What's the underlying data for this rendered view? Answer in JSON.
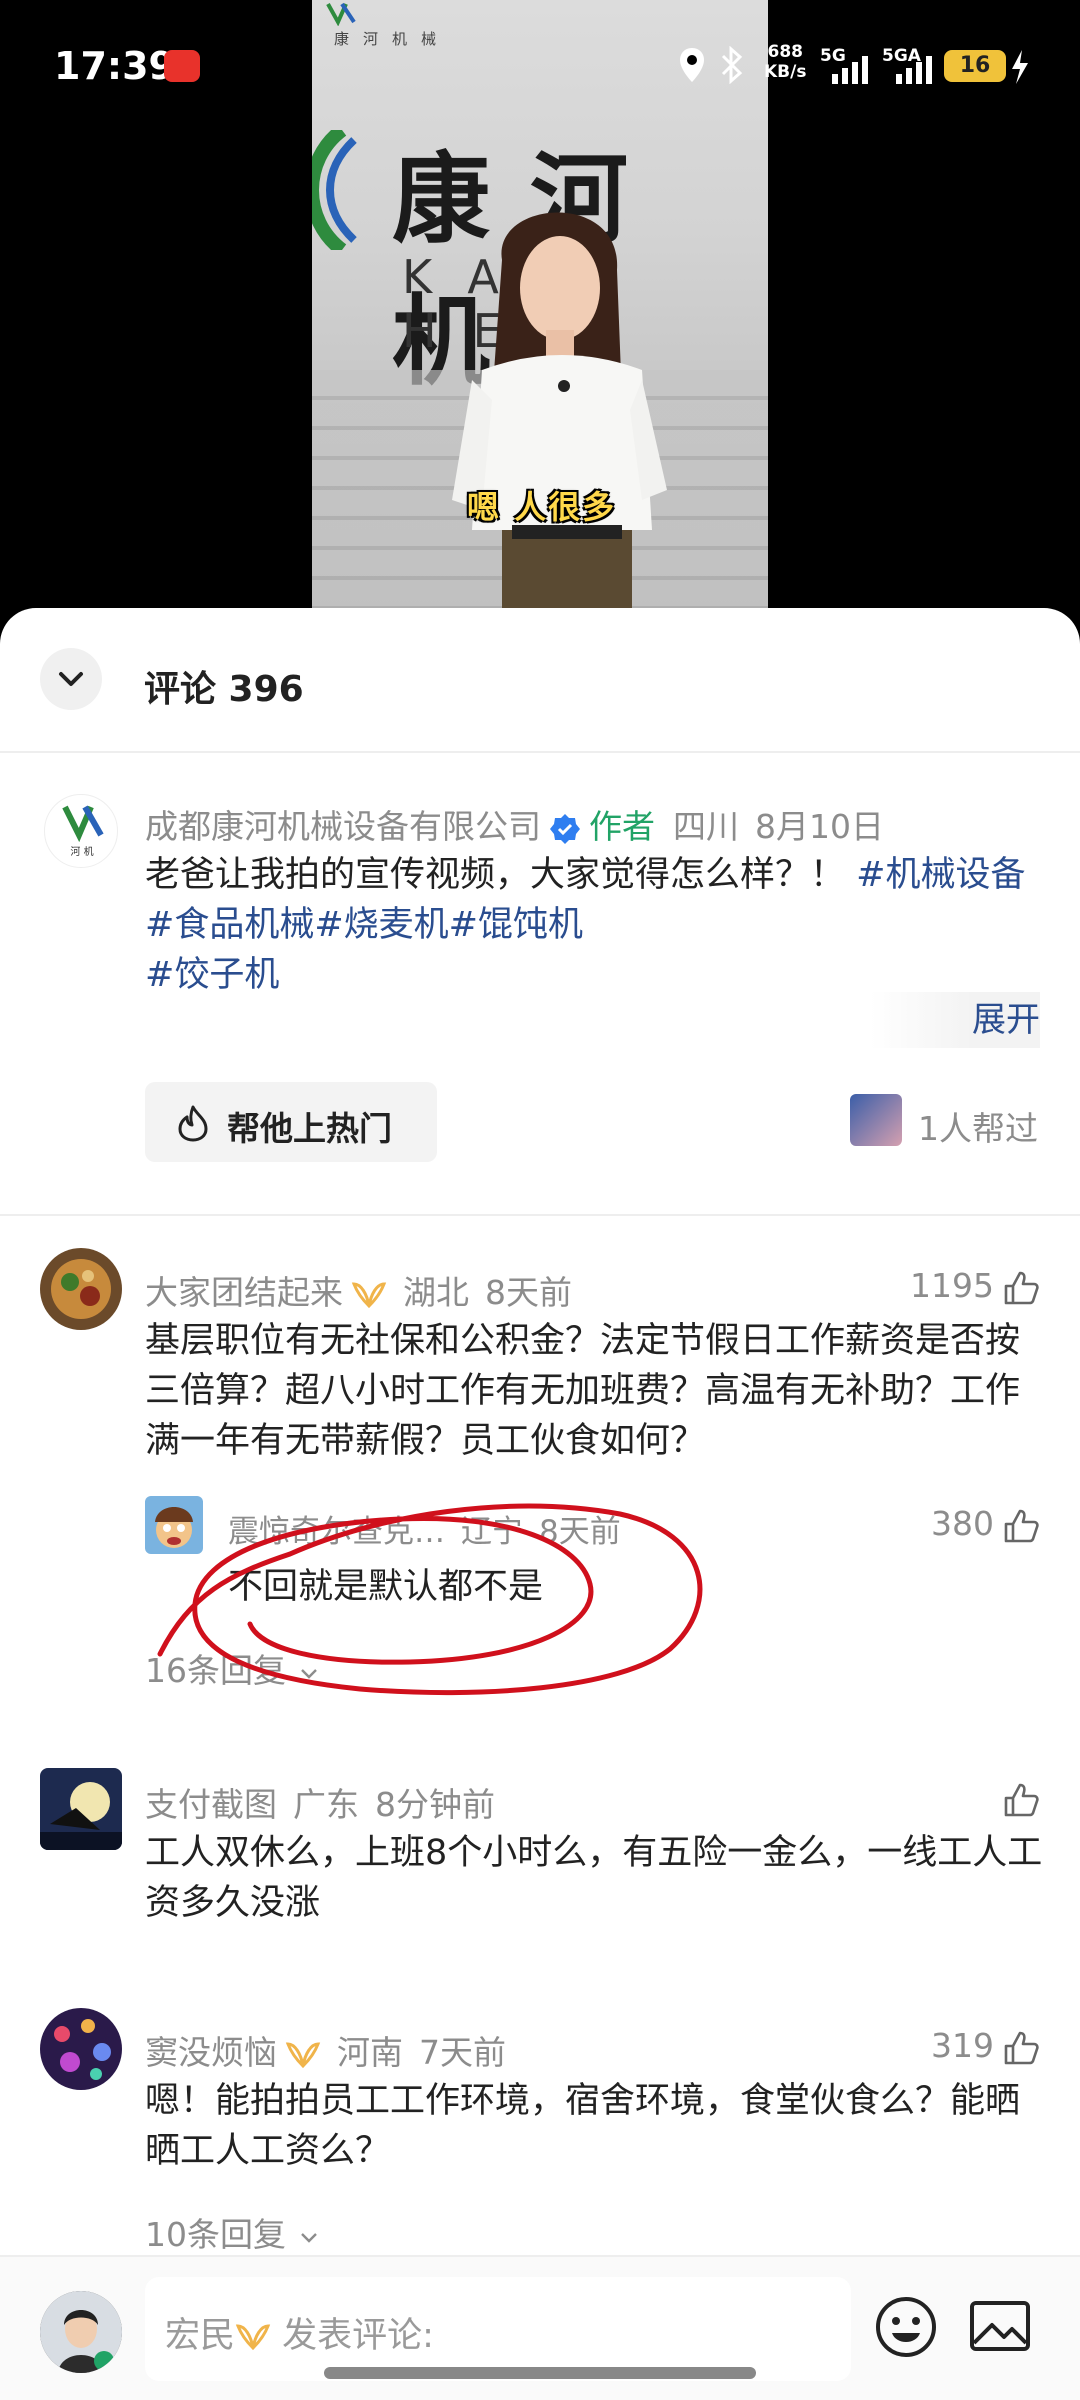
{
  "status_bar": {
    "time": "17:39",
    "net_speed_value": "688",
    "net_speed_unit": "KB/s",
    "signal1": "5G",
    "signal2": "5GA",
    "battery": "16"
  },
  "video": {
    "brand_small": "康河机械",
    "brand_big": "康河机",
    "brand_latin": "KA HEJ",
    "caption": "嗯 人很多"
  },
  "comments_header": {
    "title": "评论 396"
  },
  "author_post": {
    "name": "成都康河机械设备有限公司",
    "author_tag": "作者",
    "location": "四川",
    "date": "8月10日",
    "text": "老爸让我拍的宣传视频，大家觉得怎么样？！",
    "hashtags": [
      "#机械设备",
      "#食品机械",
      "#烧麦机",
      "#馄饨机",
      "#饺子机"
    ],
    "expand": "展开",
    "boost_button": "帮他上热门",
    "helpers": "1人帮过"
  },
  "comments": [
    {
      "user": "大家团结起来",
      "location": "湖北",
      "time": "8天前",
      "likes": "1195",
      "text": "基层职位有无社保和公积金？法定节假日工作薪资是否按三倍算？超八小时工作有无加班费？高温有无补助？工作满一年有无带薪假？员工伙食如何？",
      "reply": {
        "user": "震惊奇尔查克…",
        "location": "辽宁",
        "time": "8天前",
        "likes": "380",
        "text": "不回就是默认都不是"
      },
      "replies_label": "16条回复"
    },
    {
      "user": "支付截图",
      "location": "广东",
      "time": "8分钟前",
      "likes": "",
      "text": "工人双休么，上班8个小时么，有五险一金么，一线工人工资多久没涨"
    },
    {
      "user": "窦没烦恼",
      "location": "河南",
      "time": "7天前",
      "likes": "319",
      "text": "嗯！能拍拍员工工作环境，宿舍环境，食堂伙食么？能晒晒工人工资么？",
      "replies_label": "10条回复"
    }
  ],
  "bottom_bar": {
    "user_name": "宏民",
    "placeholder": "发表评论:"
  },
  "colors": {
    "hashtag": "#2a4d8f",
    "author_tag": "#21a366",
    "vip": "#f0b44a",
    "annotation": "#d0101c"
  }
}
